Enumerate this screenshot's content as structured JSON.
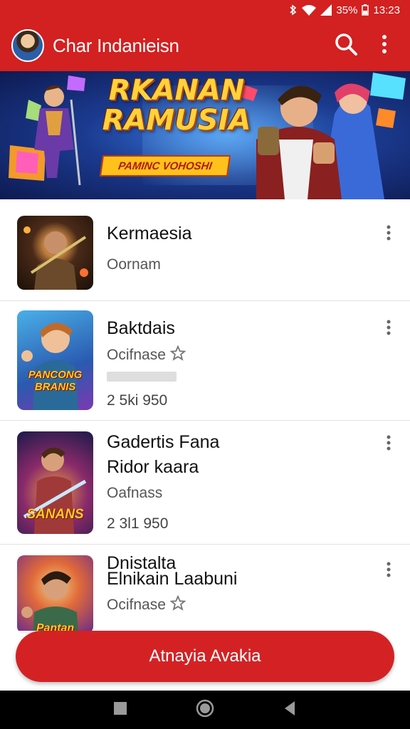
{
  "status_bar": {
    "battery": "35%",
    "time": "13:23",
    "icons": [
      "bluetooth-icon",
      "wifi-icon",
      "signal-icon",
      "battery-icon"
    ]
  },
  "app_bar": {
    "title": "Char Indanieisn",
    "icons": [
      "avatar",
      "search-icon",
      "more-vert-icon"
    ]
  },
  "banner": {
    "title_line1": "RKANAN",
    "title_line2": "RAMUSIA",
    "badge": "PAMINC VOHOSHI"
  },
  "list": {
    "items": [
      {
        "title": "Kermaesia",
        "meta": "Oornam"
      },
      {
        "title": "Baktdais",
        "meta": "Ocifnase",
        "meta_icon": "star-icon",
        "count": "2 5ki 950",
        "thumb_caption": "PANCONG BRANIS"
      },
      {
        "title": "Gadertis Fana",
        "subtitle": "Ridor kaara",
        "meta": "Oafnass",
        "count": "2 3l1 950",
        "thumb_caption": "SANANS"
      },
      {
        "title": "Dnistalta",
        "subtitle": "Elnikain Laabuni",
        "meta": "Ocifnase",
        "meta_icon": "star-icon",
        "thumb_caption": "Pantan"
      }
    ]
  },
  "action_button": {
    "label": "Atnayia Avakia"
  },
  "nav_bar": {
    "icons": [
      "back-icon",
      "home-icon",
      "recents-icon"
    ]
  },
  "colors": {
    "primary": "#d32020",
    "button": "#d42224"
  }
}
